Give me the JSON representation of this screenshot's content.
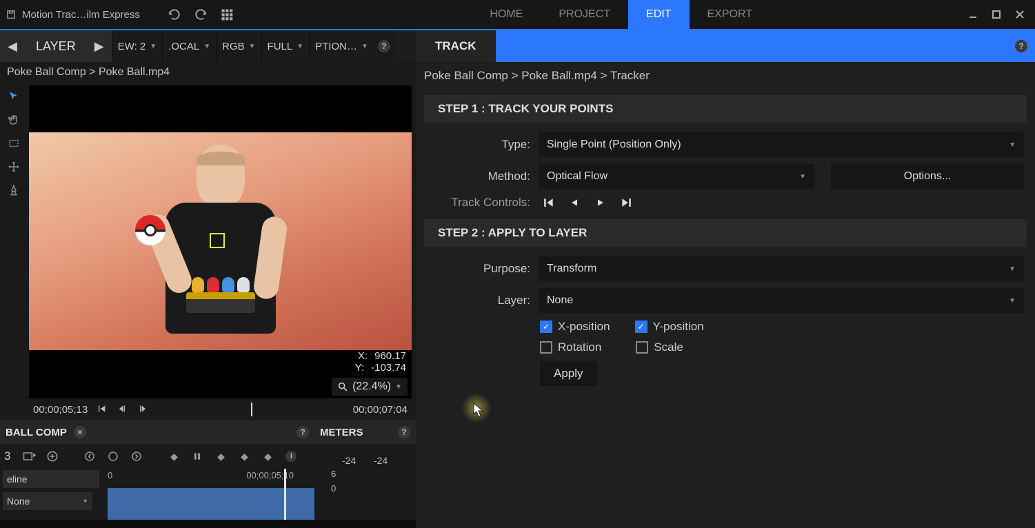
{
  "titlebar": {
    "app_title": "Motion Trac…ilm Express",
    "tabs": {
      "home": "HOME",
      "project": "PROJECT",
      "edit": "EDIT",
      "export": "EXPORT"
    }
  },
  "layerbar": {
    "label": "LAYER",
    "ew": "EW: 2",
    "local": ".OCAL",
    "rgb": "RGB",
    "full": "FULL",
    "options": "PTION…"
  },
  "viewer": {
    "breadcrumb": "Poke Ball Comp > Poke Ball.mp4",
    "x_label": "X:",
    "x_value": "960.17",
    "y_label": "Y:",
    "y_value": "-103.74",
    "zoom": "(22.4%)",
    "time_current": "00;00;05;13",
    "time_end": "00;00;07;04"
  },
  "comp": {
    "title": "BALL COMP",
    "page": "3",
    "timeline_label": "eline",
    "blend_mode": "None",
    "tick0": "0",
    "tick_mid": "00;00;05;10"
  },
  "meters": {
    "title": "METERS",
    "db1": "-24",
    "db2": "-24",
    "scale1": "6",
    "scale2": "0"
  },
  "track": {
    "tab": "TRACK",
    "breadcrumb": "Poke Ball Comp > Poke Ball.mp4 > Tracker",
    "step1_title": "STEP 1 : TRACK YOUR POINTS",
    "type_label": "Type:",
    "type_value": "Single Point (Position Only)",
    "method_label": "Method:",
    "method_value": "Optical Flow",
    "options_btn": "Options...",
    "controls_label": "Track Controls:",
    "step2_title": "STEP 2 : APPLY TO LAYER",
    "purpose_label": "Purpose:",
    "purpose_value": "Transform",
    "layer_label": "Layer:",
    "layer_value": "None",
    "check_xpos": "X-position",
    "check_ypos": "Y-position",
    "check_rot": "Rotation",
    "check_scale": "Scale",
    "apply_btn": "Apply"
  }
}
